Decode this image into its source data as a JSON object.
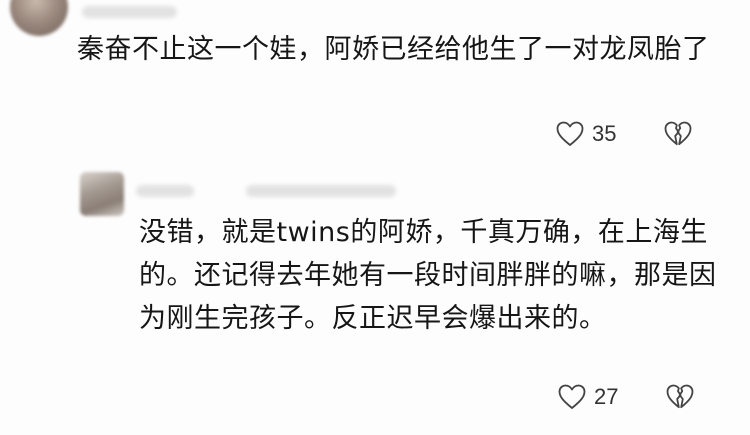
{
  "comments": [
    {
      "text": "秦奋不止这一个娃，阿娇已经给他生了一对龙凤胎了",
      "likes": "35"
    },
    {
      "text": "没错，就是twins的阿娇，千真万确，在上海生的。还记得去年她有一段时间胖胖的嘛，那是因为刚生完孩子。反正迟早会爆出来的。",
      "likes": "27"
    }
  ],
  "icons": {
    "like": "heart-outline-icon",
    "dislike": "broken-heart-icon"
  },
  "colors": {
    "text": "#161616",
    "icon_stroke": "#444444",
    "background": "#fdfdfd"
  }
}
